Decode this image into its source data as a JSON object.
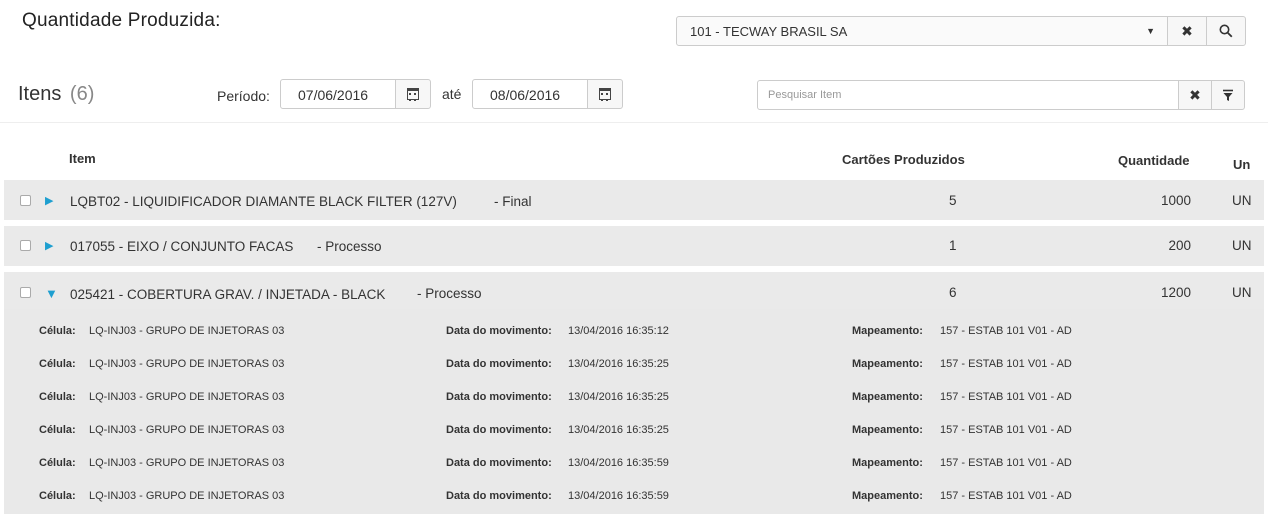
{
  "header": {
    "title": "Quantidade Produzida:",
    "company_value": "101 - TECWAY BRASIL SA"
  },
  "items_section": {
    "title": "Itens",
    "count": "(6)",
    "periodo_label": "Período:",
    "date_start": "07/06/2016",
    "ate_label": "até",
    "date_end": "08/06/2016",
    "search_placeholder": "Pesquisar Item"
  },
  "table": {
    "columns": {
      "item": "Item",
      "cartoes": "Cartões Produzidos",
      "quantidade": "Quantidade",
      "un": "Un"
    },
    "rows": [
      {
        "code": "LQBT02 - LIQUIDIFICADOR DIAMANTE BLACK FILTER (127V)",
        "type": "- Final",
        "cartoes": "5",
        "quantidade": "1000",
        "un": "UN",
        "expanded": false
      },
      {
        "code": "017055 - EIXO / CONJUNTO FACAS",
        "type": "- Processo",
        "cartoes": "1",
        "quantidade": "200",
        "un": "UN",
        "expanded": false
      },
      {
        "code": "025421 - COBERTURA GRAV. / INJETADA - BLACK",
        "type": "- Processo",
        "cartoes": "6",
        "quantidade": "1200",
        "un": "UN",
        "expanded": true
      }
    ],
    "detail_labels": {
      "celula": "Célula:",
      "data_movimento": "Data do movimento:",
      "mapeamento": "Mapeamento:"
    },
    "details": [
      {
        "celula": "LQ-INJ03 - GRUPO DE INJETORAS 03",
        "data": "13/04/2016 16:35:12",
        "mapeamento": "157 - ESTAB 101 V01 - AD"
      },
      {
        "celula": "LQ-INJ03 - GRUPO DE INJETORAS 03",
        "data": "13/04/2016 16:35:25",
        "mapeamento": "157 - ESTAB 101 V01 - AD"
      },
      {
        "celula": "LQ-INJ03 - GRUPO DE INJETORAS 03",
        "data": "13/04/2016 16:35:25",
        "mapeamento": "157 - ESTAB 101 V01 - AD"
      },
      {
        "celula": "LQ-INJ03 - GRUPO DE INJETORAS 03",
        "data": "13/04/2016 16:35:25",
        "mapeamento": "157 - ESTAB 101 V01 - AD"
      },
      {
        "celula": "LQ-INJ03 - GRUPO DE INJETORAS 03",
        "data": "13/04/2016 16:35:59",
        "mapeamento": "157 - ESTAB 101 V01 - AD"
      },
      {
        "celula": "LQ-INJ03 - GRUPO DE INJETORAS 03",
        "data": "13/04/2016 16:35:59",
        "mapeamento": "157 - ESTAB 101 V01 - AD"
      }
    ]
  },
  "colors": {
    "accent": "#1e9fd0",
    "row_bg": "#eaeaea"
  }
}
